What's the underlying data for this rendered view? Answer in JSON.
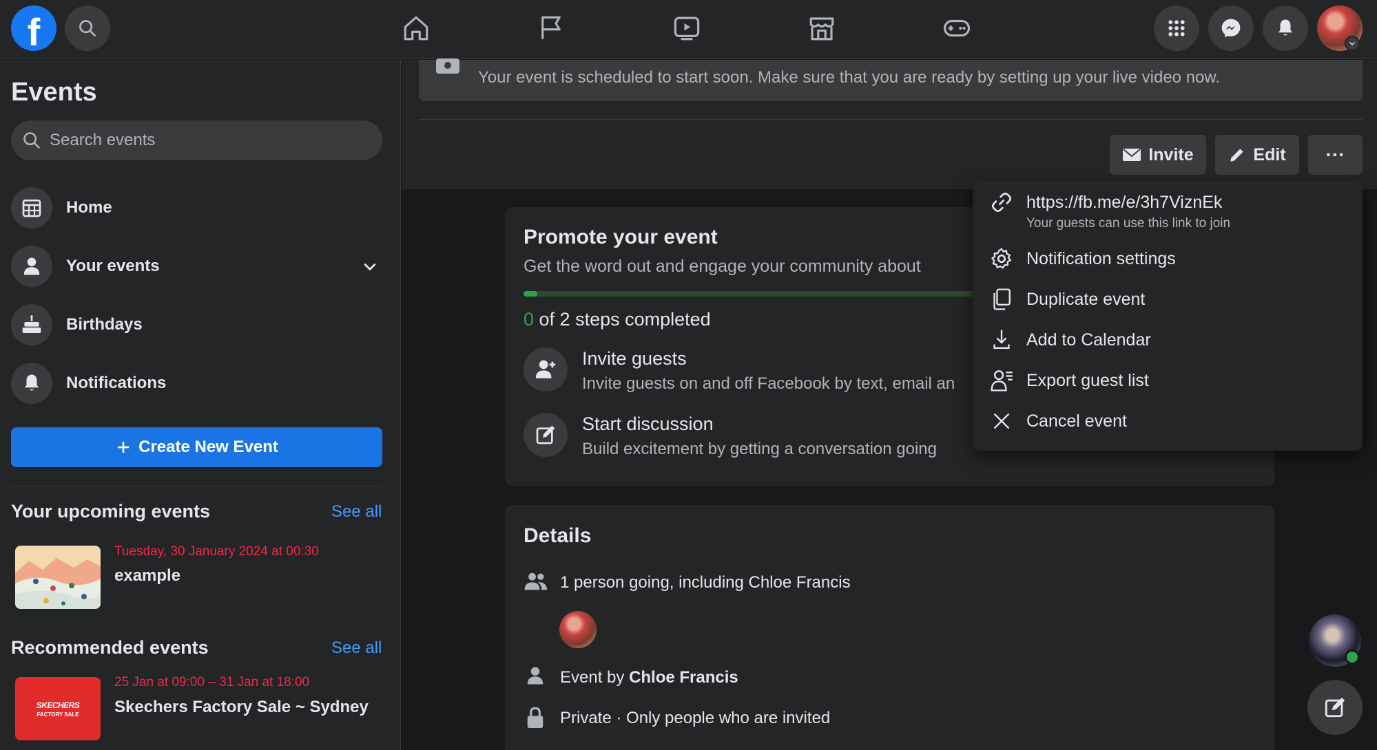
{
  "topbar": {
    "logo": "f",
    "nav_icons": [
      "home-icon",
      "flag-icon",
      "video-icon",
      "marketplace-icon",
      "gaming-icon"
    ],
    "right_icons": [
      "menu-grid-icon",
      "messenger-icon",
      "bell-icon",
      "profile-avatar"
    ]
  },
  "sidebar": {
    "title": "Events",
    "search_placeholder": "Search events",
    "items": [
      {
        "label": "Home",
        "icon": "calendar-grid-icon"
      },
      {
        "label": "Your events",
        "icon": "person-icon"
      },
      {
        "label": "Birthdays",
        "icon": "cake-icon"
      },
      {
        "label": "Notifications",
        "icon": "bell-icon"
      }
    ],
    "create_button": "Create New Event",
    "upcoming": {
      "title": "Your upcoming events",
      "see_all": "See all",
      "events": [
        {
          "date": "Tuesday, 30 January 2024 at 00:30",
          "name": "example"
        }
      ]
    },
    "recommended": {
      "title": "Recommended events",
      "see_all": "See all",
      "events": [
        {
          "date": "25 Jan at 09:00 – 31 Jan at 18:00",
          "name": "Skechers Factory Sale ~ Sydney",
          "thumb_text": "SKECHERS",
          "thumb_sub": "FACTORY SALE"
        }
      ]
    }
  },
  "main": {
    "banner_text": "Your event is scheduled to start soon. Make sure that you are ready by setting up your live video now.",
    "actions": {
      "invite": "Invite",
      "edit": "Edit",
      "more": "···"
    },
    "promote": {
      "title": "Promote your event",
      "subtitle": "Get the word out and engage your community about",
      "steps_done": "0",
      "steps_text": " of 2 steps completed",
      "progress_fraction": 0.03,
      "steps": [
        {
          "title": "Invite guests",
          "desc": "Invite guests on and off Facebook by text, email an"
        },
        {
          "title": "Start discussion",
          "desc": "Build excitement by getting a conversation going"
        }
      ]
    },
    "details": {
      "title": "Details",
      "going": "1 person going, including Chloe Francis",
      "event_by_prefix": "Event by ",
      "host": "Chloe Francis",
      "privacy": "Private · Only people who are invited"
    }
  },
  "menu": {
    "link": "https://fb.me/e/3h7ViznEk",
    "link_sub": "Your guests can use this link to join",
    "items": [
      "Notification settings",
      "Duplicate event",
      "Add to Calendar",
      "Export guest list",
      "Cancel event"
    ]
  },
  "colors": {
    "accent": "#1b74e4",
    "link": "#4599ff",
    "date_red": "#f02849",
    "progress_green": "#31a24c"
  }
}
